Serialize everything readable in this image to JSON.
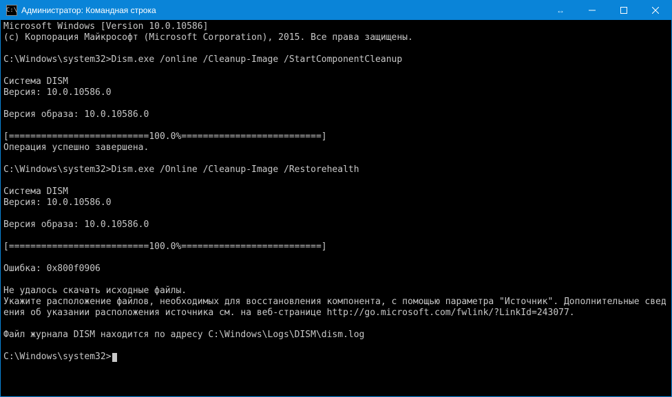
{
  "titlebar": {
    "icon_glyph": "C:\\",
    "title": "Администратор: Командная строка",
    "extra_icon_glyph": "↔"
  },
  "console": {
    "prompt1_path": "C:\\Windows\\system32>",
    "prompt1_cmd": "Dism.exe /online /Cleanup-Image /StartComponentCleanup",
    "prompt2_path": "C:\\Windows\\system32>",
    "prompt2_cmd": "Dism.exe /Online /Cleanup-Image /Restorehealth",
    "prompt3_path": "C:\\Windows\\system32>",
    "lines": [
      "Microsoft Windows [Version 10.0.10586]",
      "(c) Корпорация Майкрософт (Microsoft Corporation), 2015. Все права защищены.",
      "",
      "__PROMPT1__",
      "",
      "Система DISM",
      "Версия: 10.0.10586.0",
      "",
      "Версия образа: 10.0.10586.0",
      "",
      "[==========================100.0%==========================]",
      "Операция успешно завершена.",
      "",
      "__PROMPT2__",
      "",
      "Система DISM",
      "Версия: 10.0.10586.0",
      "",
      "Версия образа: 10.0.10586.0",
      "",
      "[==========================100.0%==========================]",
      "",
      "Ошибка: 0x800f0906",
      "",
      "Не удалось скачать исходные файлы.",
      "Укажите расположение файлов, необходимых для восстановления компонента, с помощью параметра \"Источник\". Дополнительные сведения об указании расположения источника см. на веб-странице http://go.microsoft.com/fwlink/?LinkId=243077.",
      "",
      "Файл журнала DISM находится по адресу C:\\Windows\\Logs\\DISM\\dism.log",
      "",
      "__PROMPT3__"
    ]
  }
}
